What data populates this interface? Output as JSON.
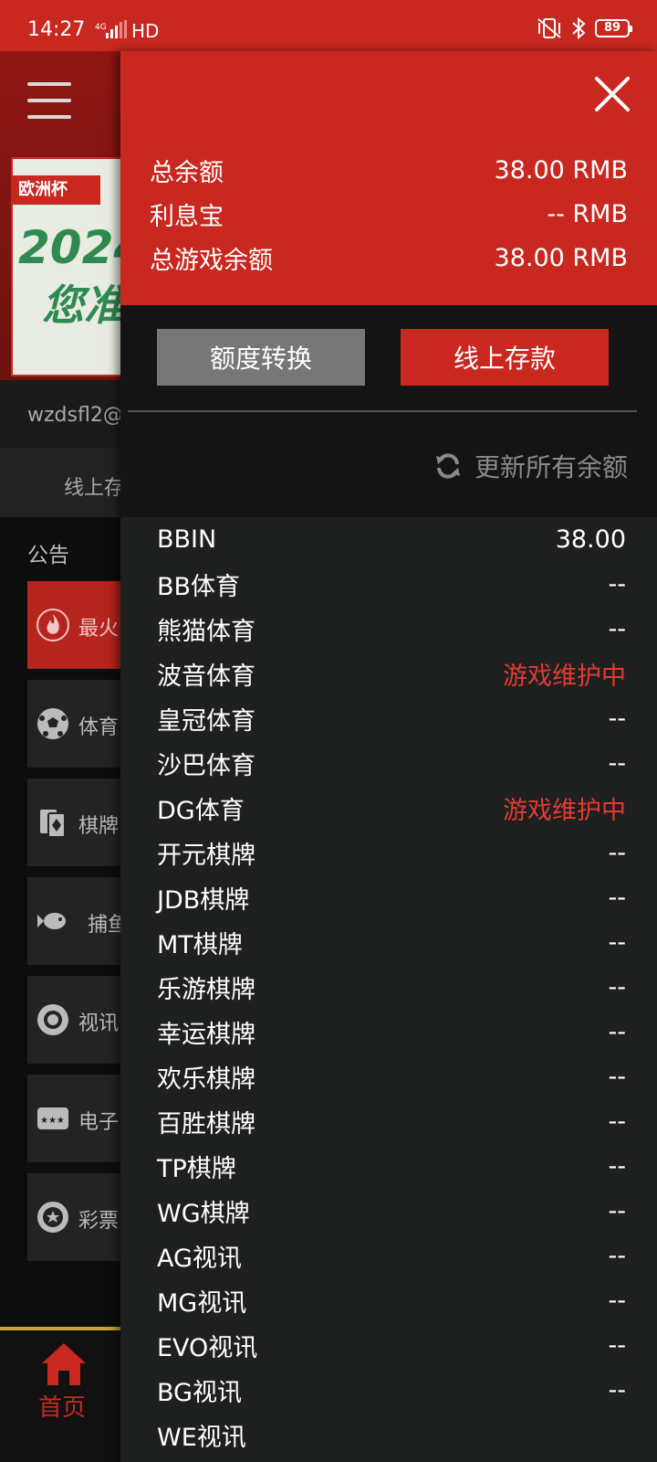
{
  "status_bar": {
    "time": "14:27",
    "network": "4G",
    "hd": "HD",
    "battery": "89"
  },
  "background": {
    "banner_ribbon": "欧洲杯",
    "banner_year": "2024",
    "banner_text": "您准",
    "username": "wzdsfl2@",
    "tab_deposit": "线上存",
    "notice_label": "公告",
    "categories": [
      {
        "label": "最火",
        "icon": "flame-icon"
      },
      {
        "label": "体育",
        "icon": "soccer-ball-icon"
      },
      {
        "label": "棋牌",
        "icon": "cards-icon"
      },
      {
        "label": "捕鱼",
        "icon": "fish-icon"
      },
      {
        "label": "视讯",
        "icon": "chip-icon"
      },
      {
        "label": "电子",
        "icon": "slot-icon"
      },
      {
        "label": "彩票",
        "icon": "lottery-icon"
      }
    ],
    "bottom_nav_home": "首页"
  },
  "drawer": {
    "balances": [
      {
        "label": "总余额",
        "value": "38.00 RMB"
      },
      {
        "label": "利息宝",
        "value": "-- RMB"
      },
      {
        "label": "总游戏余额",
        "value": "38.00 RMB"
      }
    ],
    "transfer_button": "额度转换",
    "deposit_button": "线上存款",
    "refresh_label": "更新所有余额",
    "games": [
      {
        "name": "BBIN",
        "value": "38.00",
        "maint": false
      },
      {
        "name": "BB体育",
        "value": "--",
        "maint": false
      },
      {
        "name": "熊猫体育",
        "value": "--",
        "maint": false
      },
      {
        "name": "波音体育",
        "value": "游戏维护中",
        "maint": true
      },
      {
        "name": "皇冠体育",
        "value": "--",
        "maint": false
      },
      {
        "name": "沙巴体育",
        "value": "--",
        "maint": false
      },
      {
        "name": "DG体育",
        "value": "游戏维护中",
        "maint": true
      },
      {
        "name": "开元棋牌",
        "value": "--",
        "maint": false
      },
      {
        "name": "JDB棋牌",
        "value": "--",
        "maint": false
      },
      {
        "name": "MT棋牌",
        "value": "--",
        "maint": false
      },
      {
        "name": "乐游棋牌",
        "value": "--",
        "maint": false
      },
      {
        "name": "幸运棋牌",
        "value": "--",
        "maint": false
      },
      {
        "name": "欢乐棋牌",
        "value": "--",
        "maint": false
      },
      {
        "name": "百胜棋牌",
        "value": "--",
        "maint": false
      },
      {
        "name": "TP棋牌",
        "value": "--",
        "maint": false
      },
      {
        "name": "WG棋牌",
        "value": "--",
        "maint": false
      },
      {
        "name": "AG视讯",
        "value": "--",
        "maint": false
      },
      {
        "name": "MG视讯",
        "value": "--",
        "maint": false
      },
      {
        "name": "EVO视讯",
        "value": "--",
        "maint": false
      },
      {
        "name": "BG视讯",
        "value": "--",
        "maint": false
      },
      {
        "name": "WE视讯",
        "value": "",
        "maint": false
      }
    ]
  }
}
